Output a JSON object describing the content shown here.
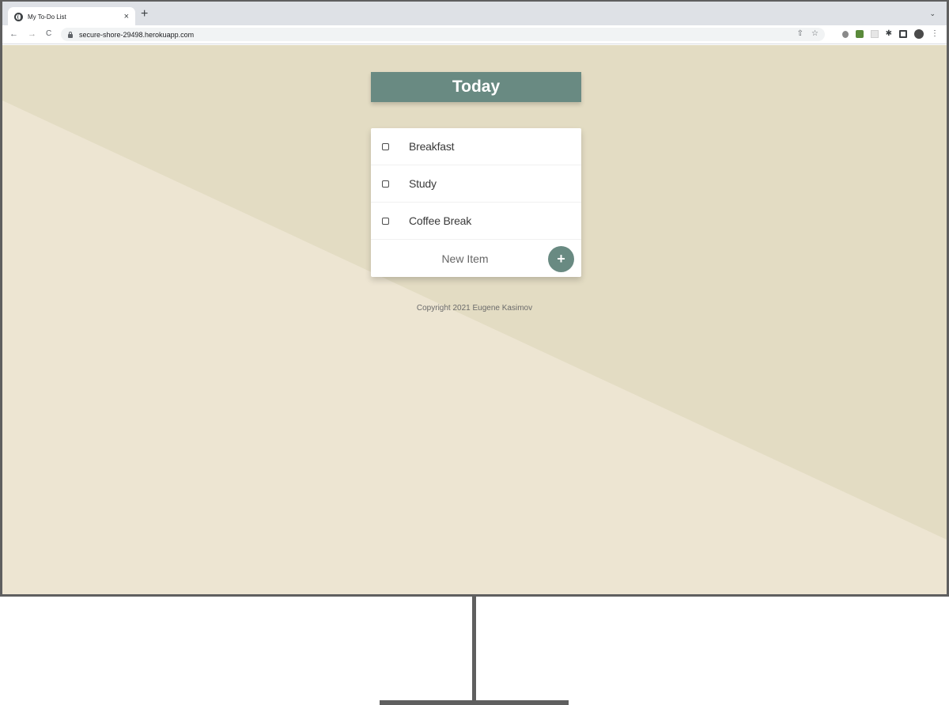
{
  "browser": {
    "tab_title": "My To-Do List",
    "tab_close": "×",
    "new_tab": "+",
    "tab_search": "⌄",
    "url": "secure-shore-29498.herokuapp.com",
    "nav": {
      "back": "←",
      "forward": "→",
      "reload": "C"
    },
    "omni_icons": {
      "share": "⇧",
      "bookmark": "☆"
    },
    "menu_icon": "⋮",
    "puzzle_icon": "✱"
  },
  "page": {
    "colors": {
      "bg_light": "#ede5d2",
      "bg_dark": "#e3dcc3",
      "accent": "#698a82"
    },
    "heading": "Today",
    "items": [
      {
        "label": "Breakfast",
        "checked": false
      },
      {
        "label": "Study",
        "checked": false
      },
      {
        "label": "Coffee Break",
        "checked": false
      }
    ],
    "new_item": {
      "placeholder": "New Item",
      "value": ""
    },
    "add_button": "+",
    "footer": "Copyright 2021 Eugene Kasimov"
  }
}
